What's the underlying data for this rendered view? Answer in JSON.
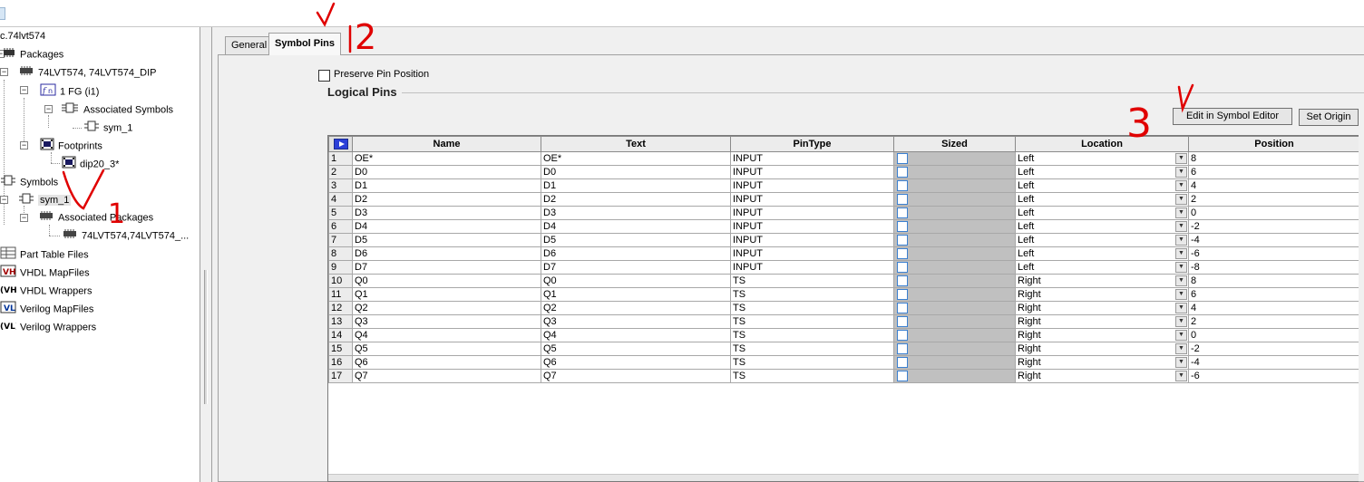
{
  "tree": {
    "root": "c.74lvt574",
    "packages": "Packages",
    "package_item": "74LVT574, 74LVT574_DIP",
    "function_group": "1 FG (i1)",
    "associated_symbols": "Associated Symbols",
    "symbol_item": "sym_1",
    "footprints": "Footprints",
    "footprint_item": "dip20_3*",
    "symbols": "Symbols",
    "symbol_node": "sym_1",
    "associated_packages": "Associated Packages",
    "assoc_package_item": "74LVT574,74LVT574_...",
    "part_table_files": "Part Table Files",
    "vhdl_mapfiles": "VHDL MapFiles",
    "vhdl_wrappers": "VHDL Wrappers",
    "verilog_mapfiles": "Verilog MapFiles",
    "verilog_wrappers": "Verilog Wrappers"
  },
  "icons": {
    "packages_ico": "chip-icon",
    "function_ico": "function-icon",
    "symbol_ico": "symbol-icon",
    "footprint_ico": "footprint-icon",
    "vhdl_map_ico": "vhdl-map-icon",
    "vhdl_wrap_ico": "vhdl-wrapper-icon",
    "verilog_map_ico": "verilog-map-icon",
    "verilog_wrap_ico": "verilog-wrapper-icon"
  },
  "tabs": {
    "general": "General",
    "symbol_pins": "Symbol Pins"
  },
  "panel": {
    "preserve_pin_position": "Preserve Pin Position",
    "logical_pins": "Logical Pins",
    "edit_in_symbol_editor": "Edit in Symbol Editor",
    "set_origin": "Set Origin"
  },
  "grid": {
    "headers": [
      "Name",
      "Text",
      "PinType",
      "Sized",
      "Location",
      "Position"
    ],
    "rows": [
      {
        "num": "1",
        "name": "OE*",
        "text": "OE*",
        "type": "INPUT",
        "location": "Left",
        "position": "8"
      },
      {
        "num": "2",
        "name": "D0",
        "text": "D0",
        "type": "INPUT",
        "location": "Left",
        "position": "6"
      },
      {
        "num": "3",
        "name": "D1",
        "text": "D1",
        "type": "INPUT",
        "location": "Left",
        "position": "4"
      },
      {
        "num": "4",
        "name": "D2",
        "text": "D2",
        "type": "INPUT",
        "location": "Left",
        "position": "2"
      },
      {
        "num": "5",
        "name": "D3",
        "text": "D3",
        "type": "INPUT",
        "location": "Left",
        "position": "0"
      },
      {
        "num": "6",
        "name": "D4",
        "text": "D4",
        "type": "INPUT",
        "location": "Left",
        "position": "-2"
      },
      {
        "num": "7",
        "name": "D5",
        "text": "D5",
        "type": "INPUT",
        "location": "Left",
        "position": "-4"
      },
      {
        "num": "8",
        "name": "D6",
        "text": "D6",
        "type": "INPUT",
        "location": "Left",
        "position": "-6"
      },
      {
        "num": "9",
        "name": "D7",
        "text": "D7",
        "type": "INPUT",
        "location": "Left",
        "position": "-8"
      },
      {
        "num": "10",
        "name": "Q0",
        "text": "Q0",
        "type": "TS",
        "location": "Right",
        "position": "8"
      },
      {
        "num": "11",
        "name": "Q1",
        "text": "Q1",
        "type": "TS",
        "location": "Right",
        "position": "6"
      },
      {
        "num": "12",
        "name": "Q2",
        "text": "Q2",
        "type": "TS",
        "location": "Right",
        "position": "4"
      },
      {
        "num": "13",
        "name": "Q3",
        "text": "Q3",
        "type": "TS",
        "location": "Right",
        "position": "2"
      },
      {
        "num": "14",
        "name": "Q4",
        "text": "Q4",
        "type": "TS",
        "location": "Right",
        "position": "0"
      },
      {
        "num": "15",
        "name": "Q5",
        "text": "Q5",
        "type": "TS",
        "location": "Right",
        "position": "-2"
      },
      {
        "num": "16",
        "name": "Q6",
        "text": "Q6",
        "type": "TS",
        "location": "Right",
        "position": "-4"
      },
      {
        "num": "17",
        "name": "Q7",
        "text": "Q7",
        "type": "TS",
        "location": "Right",
        "position": "-6"
      }
    ]
  },
  "annotations": {
    "step1": "1",
    "step2": "2",
    "step3": "3",
    "color": "#e00000"
  }
}
